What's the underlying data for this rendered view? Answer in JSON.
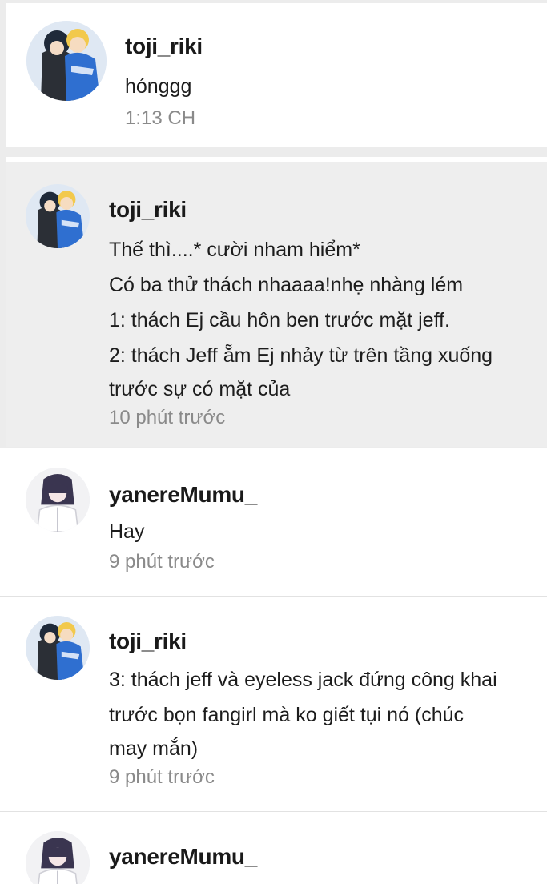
{
  "comments": [
    {
      "username": "toji_riki",
      "avatar": "anime-couple-avatar-icon",
      "lines": [
        "hónggg"
      ],
      "time": "1:13 CH"
    },
    {
      "username": "toji_riki",
      "avatar": "anime-couple-avatar-icon",
      "lines": [
        "Thế thì....* cười nham hiểm*",
        "Có ba thử thách nhaaaa!nhẹ nhàng lém",
        "1: thách Ej cầu hôn ben trước mặt jeff.",
        "2: thách Jeff ẵm Ej nhảy từ trên tầng xuống",
        "trước sự có mặt của"
      ],
      "time": "10 phút trước"
    },
    {
      "username": "yanereMumu_",
      "avatar": "dark-hair-character-avatar-icon",
      "lines": [
        "Hay"
      ],
      "time": "9 phút trước"
    },
    {
      "username": "toji_riki",
      "avatar": "anime-couple-avatar-icon",
      "lines": [
        "3: thách jeff và eyeless jack đứng công khai",
        "trước bọn fangirl mà ko giết tụi nó (chúc",
        "may mắn)"
      ],
      "time": "9 phút trước"
    },
    {
      "username": "yanereMumu_",
      "avatar": "dark-hair-character-avatar-icon",
      "lines": [],
      "time": ""
    }
  ],
  "colors": {
    "page_background": "#ececec",
    "card_background": "#ffffff",
    "highlighted_card": "#eeeeee",
    "username": "#1a1a1a",
    "timestamp": "#8a8a8a"
  }
}
